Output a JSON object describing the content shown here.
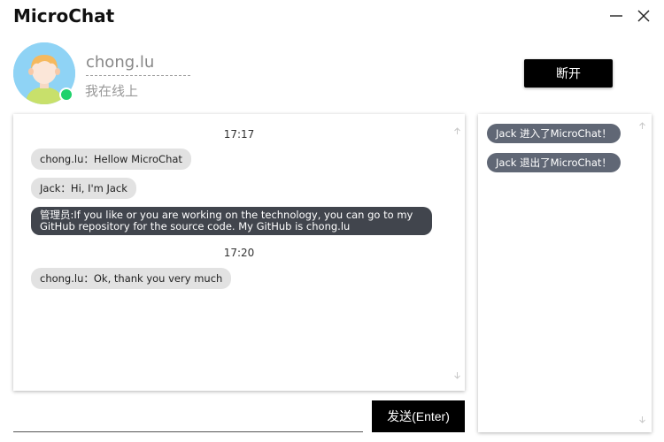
{
  "app": {
    "title": "MicroChat"
  },
  "window_controls": {
    "minimize_icon": "minimize-icon",
    "close_icon": "close-icon"
  },
  "user": {
    "name": "chong.lu",
    "status": "我在线上",
    "online_color": "#1fd26b"
  },
  "actions": {
    "disconnect_label": "断开",
    "send_label": "发送(Enter)"
  },
  "chat": {
    "times": [
      "17:17",
      "17:20"
    ],
    "messages": [
      {
        "text": "chong.lu：Hellow MicroChat"
      },
      {
        "text": "Jack：Hi, I'm Jack"
      },
      {
        "text": "管理员:If you like or you are working on the technology, you can go to my GitHub repository for the source code. My GitHub is chong.lu"
      },
      {
        "text": "chong.lu：Ok, thank you very much"
      }
    ]
  },
  "events": [
    {
      "text": "Jack 进入了MicroChat！"
    },
    {
      "text": "Jack 退出了MicroChat！"
    }
  ],
  "input": {
    "placeholder": "",
    "value": ""
  },
  "colors": {
    "primary": "#000000",
    "admin_bubble": "#41454d",
    "user_bubble": "#e2e2e2",
    "event_pill": "#606775"
  }
}
